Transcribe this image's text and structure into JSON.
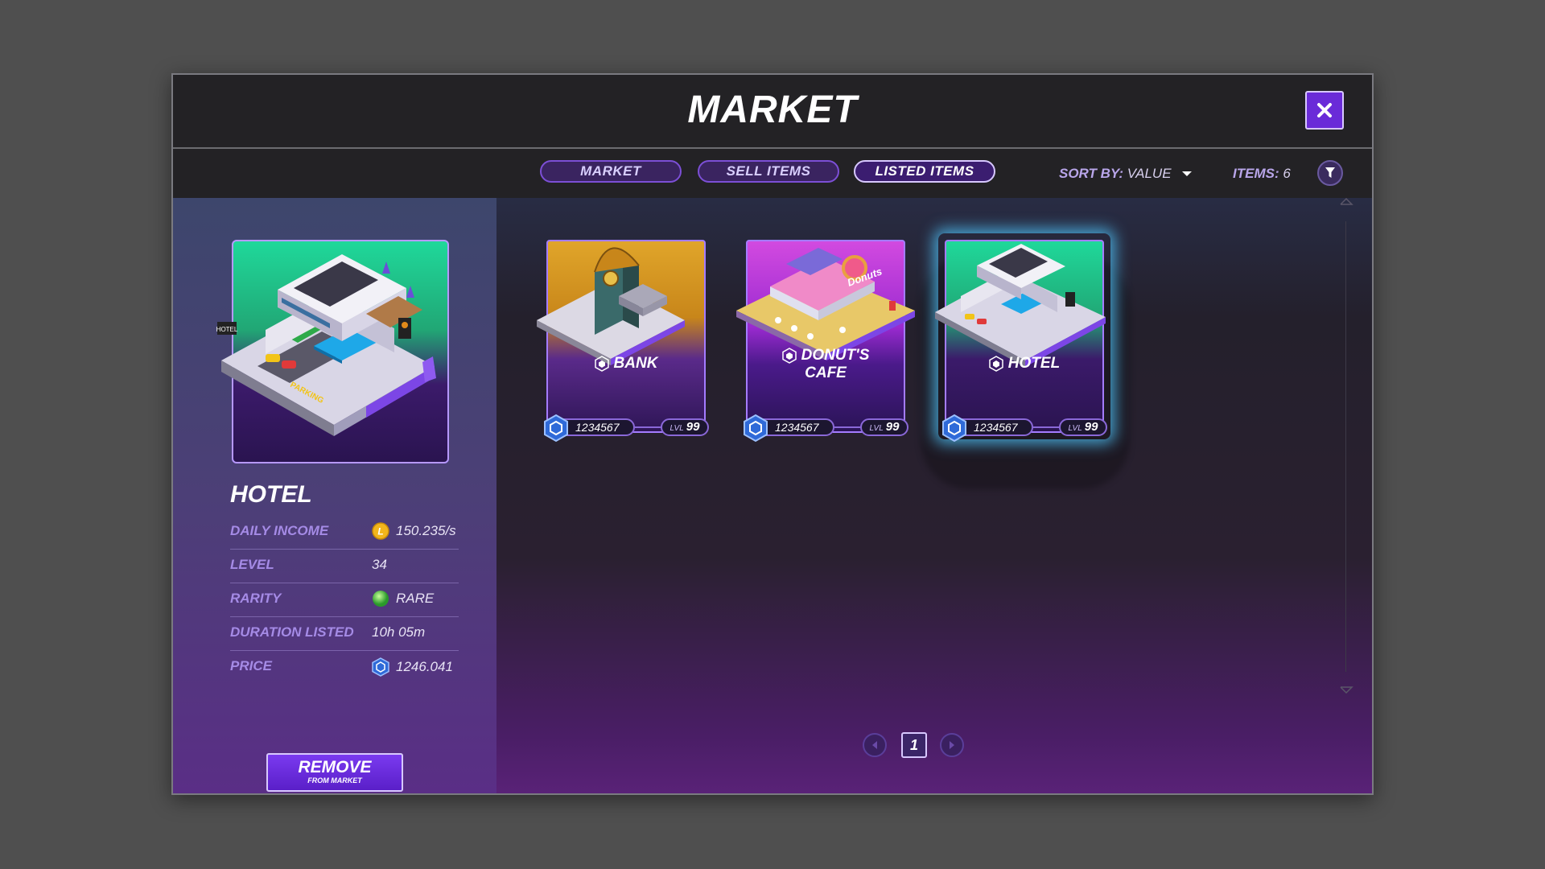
{
  "title": "MARKET",
  "tabs": [
    {
      "label": "MARKET",
      "active": false
    },
    {
      "label": "SELL ITEMS",
      "active": false
    },
    {
      "label": "LISTED ITEMS",
      "active": true
    }
  ],
  "sort": {
    "label": "SORT BY:",
    "value": "VALUE"
  },
  "items": {
    "label": "ITEMS:",
    "count": "6"
  },
  "detail": {
    "name": "HOTEL",
    "image_sign": "HOTEL",
    "image_parking": "PARKING",
    "stats": [
      {
        "label": "DAILY INCOME",
        "value": "150.235/s",
        "icon": "gold-coin-icon"
      },
      {
        "label": "LEVEL",
        "value": "34"
      },
      {
        "label": "RARITY",
        "value": "RARE",
        "icon": "rarity-green-orb-icon"
      },
      {
        "label": "DURATION LISTED",
        "value": "10h 05m"
      },
      {
        "label": "PRICE",
        "value": "1246.041",
        "icon": "crypto-token-icon"
      }
    ],
    "remove_button": {
      "main": "REMOVE",
      "sub": "FROM MARKET"
    }
  },
  "cards": [
    {
      "name": "BANK",
      "price": "1234567",
      "lvl_label": "LVL",
      "lvl": "99",
      "theme": "gold",
      "selected": false
    },
    {
      "name_line1": "DONUT'S",
      "name_line2": "CAFE",
      "sign": "Donuts",
      "price": "1234567",
      "lvl_label": "LVL",
      "lvl": "99",
      "theme": "pink",
      "selected": false
    },
    {
      "name": "HOTEL",
      "price": "1234567",
      "lvl_label": "LVL",
      "lvl": "99",
      "theme": "green",
      "selected": true
    }
  ],
  "pagination": {
    "current": "1"
  },
  "colors": {
    "accent": "#6a2bd8",
    "tab_border": "#7c4fd6",
    "label": "#a58be6",
    "glow": "#50c8ff"
  }
}
